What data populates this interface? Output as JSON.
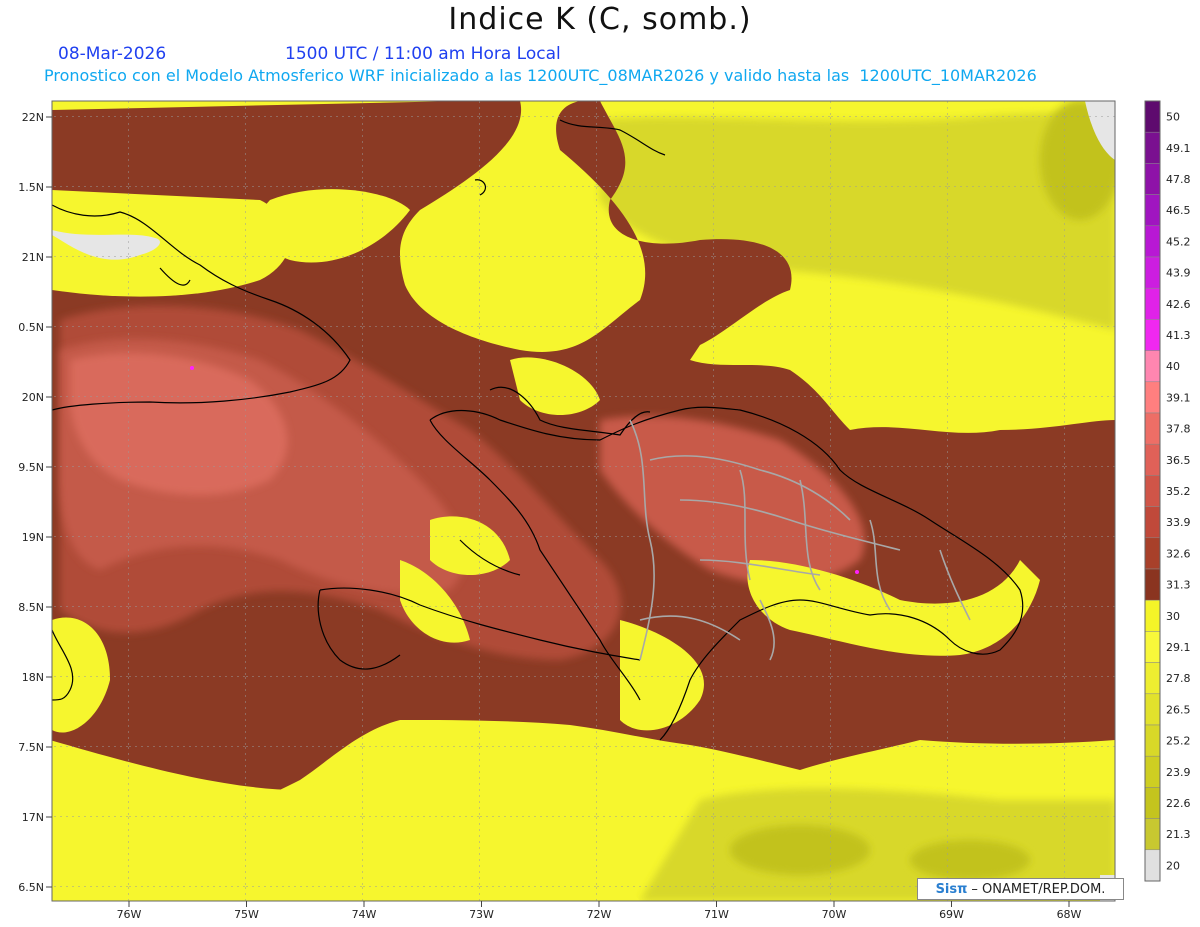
{
  "header": {
    "title": "Indice K (C, somb.)",
    "date": "08-Mar-2026",
    "time": "1500 UTC / 11:00 am Hora Local",
    "description": "Pronostico con el Modelo Atmosferico WRF inicializado a las 1200UTC_08MAR2026 y valido hasta las  1200UTC_10MAR2026"
  },
  "axes": {
    "lat_labels": [
      "22N",
      "1.5N",
      "21N",
      "0.5N",
      "20N",
      "9.5N",
      "19N",
      "8.5N",
      "18N",
      "7.5N",
      "17N",
      "6.5N"
    ],
    "lon_labels": [
      "76W",
      "75W",
      "74W",
      "73W",
      "72W",
      "71W",
      "70W",
      "69W",
      "68W"
    ]
  },
  "colorbar": {
    "labels": [
      "50",
      "49.1",
      "47.8",
      "46.5",
      "45.2",
      "43.9",
      "42.6",
      "41.3",
      "40",
      "39.1",
      "37.8",
      "36.5",
      "35.2",
      "33.9",
      "32.6",
      "31.3",
      "30",
      "29.1",
      "27.8",
      "26.5",
      "25.2",
      "23.9",
      "22.6",
      "21.3",
      "20"
    ],
    "colors": [
      "#5e0a6e",
      "#7a1090",
      "#8e12a8",
      "#a015c0",
      "#b818d4",
      "#cc1ee0",
      "#e022e8",
      "#f028f0",
      "#ff86b0",
      "#ff7f7f",
      "#ee6e66",
      "#e06158",
      "#d05548",
      "#c0493a",
      "#a8402a",
      "#8a3420",
      "#f4f428",
      "#f8f83a",
      "#eeee30",
      "#e2e22c",
      "#d8d828",
      "#cece22",
      "#c4c41e",
      "#c8c830",
      "#e0e0e0"
    ]
  },
  "credit": {
    "brand": "Sisπ",
    "org": "– ONAMET/REP.DOM."
  },
  "colors": {
    "yellow": "#f6f62e",
    "brown": "#8b3a24",
    "salmon": "#d4685a",
    "olive": "#cccc30",
    "land_gray": "#e6e6e6"
  }
}
